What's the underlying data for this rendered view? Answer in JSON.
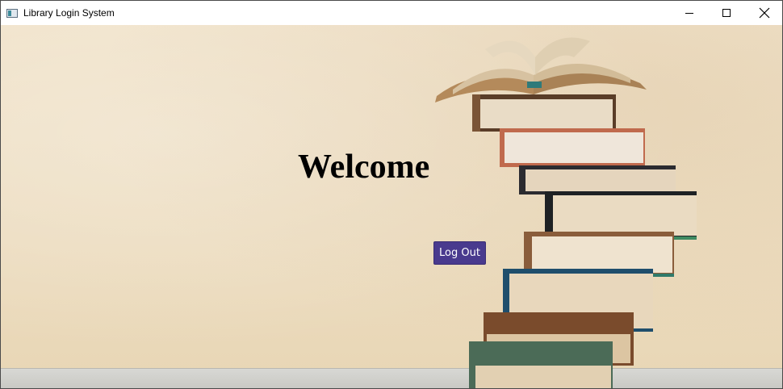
{
  "window": {
    "title": "Library Login System",
    "controls": {
      "minimize": "minimize-icon",
      "maximize": "maximize-icon",
      "close": "close-icon"
    }
  },
  "main": {
    "heading": "Welcome",
    "logout_label": "Log Out",
    "button_color": "#493a8e"
  },
  "background": {
    "image": "book-stack-on-shelf"
  }
}
